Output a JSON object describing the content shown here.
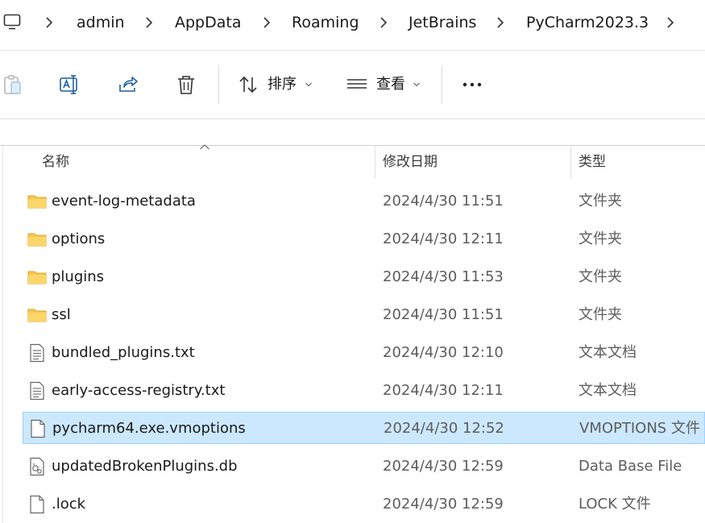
{
  "breadcrumb": {
    "segments": [
      "admin",
      "AppData",
      "Roaming",
      "JetBrains",
      "PyCharm2023.3"
    ]
  },
  "toolbar": {
    "sort_label": "排序",
    "view_label": "查看"
  },
  "columns": {
    "name": "名称",
    "modified": "修改日期",
    "type": "类型"
  },
  "files": [
    {
      "name": "event-log-metadata",
      "modified": "2024/4/30 11:51",
      "type": "文件夹",
      "icon": "folder-icon"
    },
    {
      "name": "options",
      "modified": "2024/4/30 12:11",
      "type": "文件夹",
      "icon": "folder-icon"
    },
    {
      "name": "plugins",
      "modified": "2024/4/30 11:53",
      "type": "文件夹",
      "icon": "folder-icon"
    },
    {
      "name": "ssl",
      "modified": "2024/4/30 11:51",
      "type": "文件夹",
      "icon": "folder-icon"
    },
    {
      "name": "bundled_plugins.txt",
      "modified": "2024/4/30 12:10",
      "type": "文本文档",
      "icon": "text-file-icon"
    },
    {
      "name": "early-access-registry.txt",
      "modified": "2024/4/30 12:11",
      "type": "文本文档",
      "icon": "text-file-icon"
    },
    {
      "name": "pycharm64.exe.vmoptions",
      "modified": "2024/4/30 12:52",
      "type": "VMOPTIONS 文件",
      "icon": "file-icon",
      "selected": true
    },
    {
      "name": "updatedBrokenPlugins.db",
      "modified": "2024/4/30 12:59",
      "type": "Data Base File",
      "icon": "db-file-icon"
    },
    {
      "name": ".lock",
      "modified": "2024/4/30 12:59",
      "type": "LOCK 文件",
      "icon": "file-icon"
    }
  ],
  "colors": {
    "selection_bg": "#cce8ff",
    "selection_border": "#99d1ff",
    "folder_yellow": "#f8c84a",
    "muted_text": "#5d5d5d"
  }
}
